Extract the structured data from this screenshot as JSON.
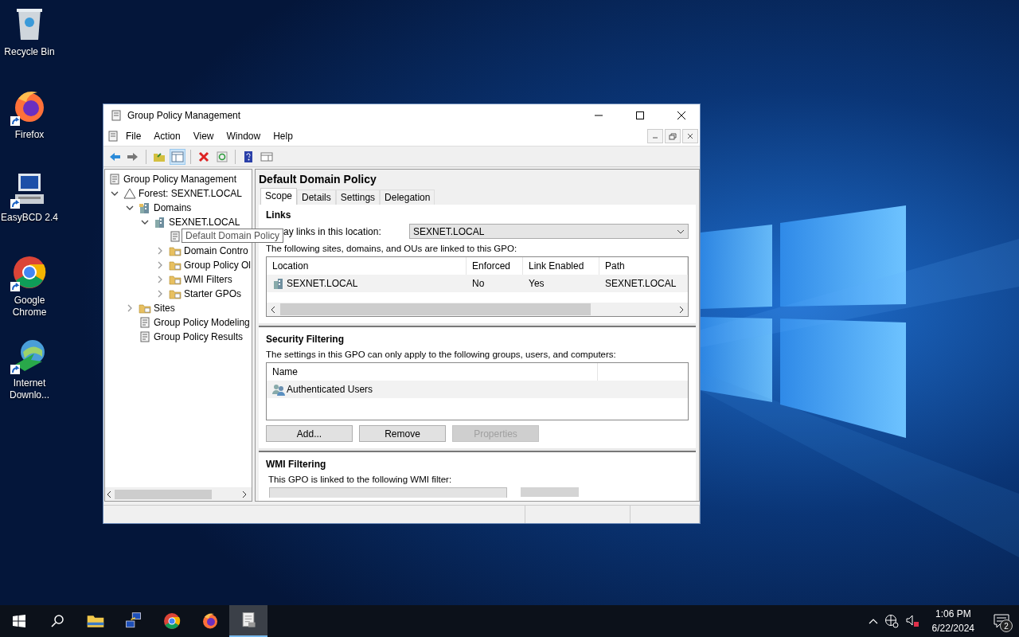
{
  "desktop_icons": [
    {
      "label": "Recycle Bin",
      "kind": "recycle",
      "shortcut": false
    },
    {
      "label": "Firefox",
      "kind": "firefox",
      "shortcut": true
    },
    {
      "label": "EasyBCD 2.4",
      "kind": "computer",
      "shortcut": true
    },
    {
      "label": "Google Chrome",
      "kind": "chrome",
      "shortcut": true
    },
    {
      "label": "Internet Downlo...",
      "kind": "globe",
      "shortcut": true
    }
  ],
  "window": {
    "title": "Group Policy Management",
    "menu": [
      "File",
      "Action",
      "View",
      "Window",
      "Help"
    ],
    "tree": [
      {
        "label": "Group Policy Management",
        "kind": "root",
        "children": [
          {
            "label": "Forest: SEXNET.LOCAL",
            "kind": "forest",
            "expanded": true,
            "children": [
              {
                "label": "Domains",
                "kind": "domains",
                "expanded": true,
                "children": [
                  {
                    "label": "SEXNET.LOCAL",
                    "kind": "domain",
                    "expanded": true,
                    "children": [
                      {
                        "kind": "gpo",
                        "tooltip": "Default Domain Policy"
                      },
                      {
                        "label": "Domain Contro",
                        "kind": "ou",
                        "expanded": false
                      },
                      {
                        "label": "Group Policy Ol",
                        "kind": "gpos",
                        "expanded": false
                      },
                      {
                        "label": "WMI Filters",
                        "kind": "wmi",
                        "expanded": false
                      },
                      {
                        "label": "Starter GPOs",
                        "kind": "starter",
                        "expanded": false
                      }
                    ]
                  }
                ]
              },
              {
                "label": "Sites",
                "kind": "sites",
                "expanded": false
              },
              {
                "label": "Group Policy Modeling",
                "kind": "modeling"
              },
              {
                "label": "Group Policy Results",
                "kind": "results"
              }
            ]
          }
        ]
      }
    ],
    "detail": {
      "title": "Default Domain Policy",
      "tabs": [
        {
          "label": "Scope",
          "selected": true
        },
        {
          "label": "Details",
          "selected": false
        },
        {
          "label": "Settings",
          "selected": false
        },
        {
          "label": "Delegation",
          "selected": false
        }
      ],
      "links": {
        "heading": "Links",
        "display_label": "ay links in this location:",
        "location": "SEXNET.LOCAL",
        "linked_text": "The following sites, domains, and OUs are linked to this GPO:",
        "columns": [
          "Location",
          "Enforced",
          "Link Enabled",
          "Path"
        ],
        "rows": [
          [
            "SEXNET.LOCAL",
            "No",
            "Yes",
            "SEXNET.LOCAL"
          ]
        ]
      },
      "security": {
        "heading": "Security Filtering",
        "text": "The settings in this GPO can only apply to the following groups, users, and computers:",
        "columns": [
          "Name"
        ],
        "rows": [
          "Authenticated Users"
        ],
        "buttons": [
          {
            "label": "Add...",
            "disabled": false
          },
          {
            "label": "Remove",
            "disabled": false
          },
          {
            "label": "Properties",
            "disabled": true
          }
        ]
      },
      "wmi": {
        "heading": "WMI Filtering",
        "text": "This GPO is linked to the following WMI filter:"
      }
    }
  },
  "taskbar": {
    "apps": [
      {
        "kind": "explorer",
        "active": false
      },
      {
        "kind": "network",
        "active": false
      },
      {
        "kind": "chrome",
        "active": false
      },
      {
        "kind": "firefox",
        "active": false
      },
      {
        "kind": "gpm",
        "active": true
      }
    ],
    "time": "1:06 PM",
    "date": "6/22/2024",
    "notifications": "2"
  }
}
